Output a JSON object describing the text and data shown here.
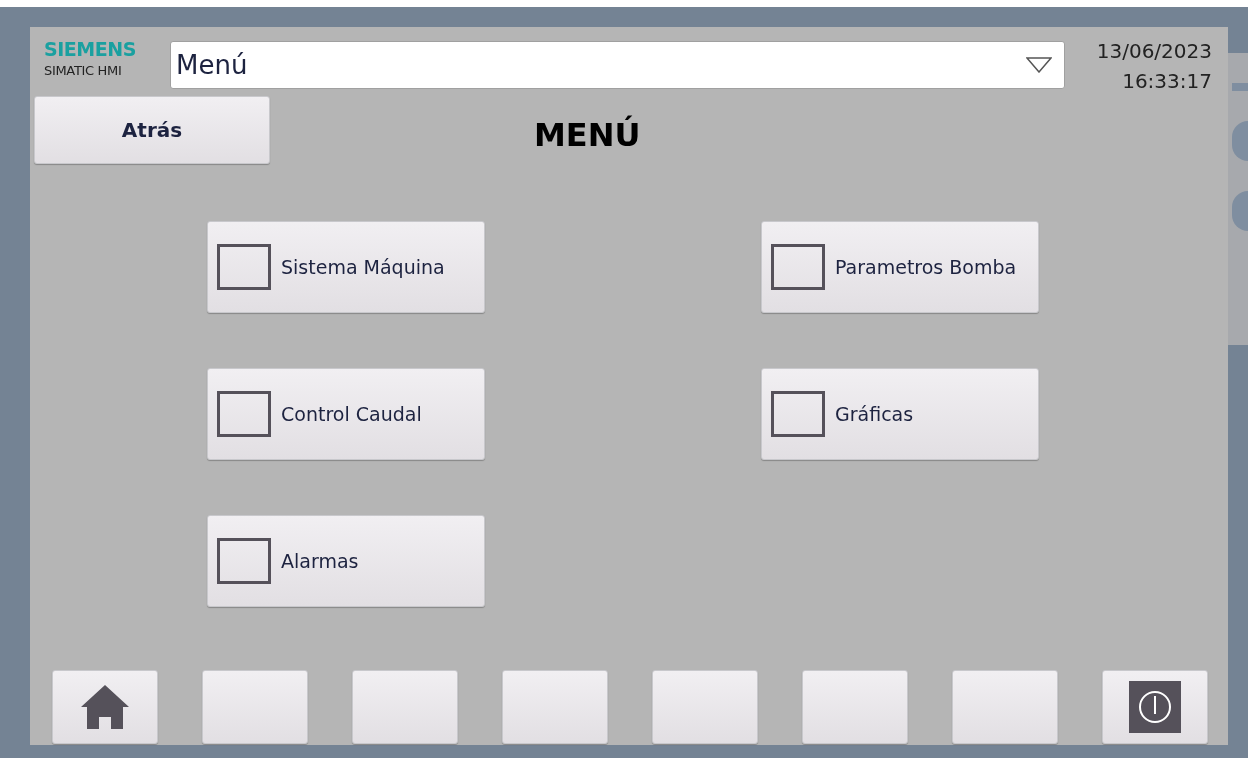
{
  "header": {
    "brand": "SIEMENS",
    "product": "SIMATIC HMI",
    "screen_select": {
      "value": "Menú"
    },
    "date": "13/06/2023",
    "time": "16:33:17"
  },
  "back_button": {
    "label": "Atrás"
  },
  "title": "MENÚ",
  "menu_buttons": [
    {
      "label": "Sistema Máquina"
    },
    {
      "label": "Parametros Bomba"
    },
    {
      "label": "Control Caudal"
    },
    {
      "label": "Gráficas"
    },
    {
      "label": "Alarmas"
    }
  ],
  "function_keys": [
    {
      "kind": "home"
    },
    {
      "kind": "blank"
    },
    {
      "kind": "blank"
    },
    {
      "kind": "blank"
    },
    {
      "kind": "blank"
    },
    {
      "kind": "blank"
    },
    {
      "kind": "blank"
    },
    {
      "kind": "power"
    }
  ]
}
